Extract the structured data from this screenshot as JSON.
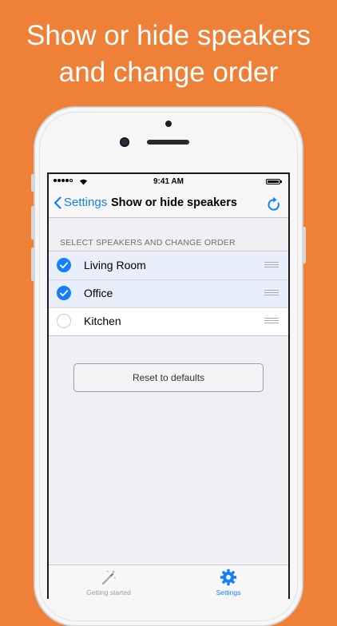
{
  "headline": {
    "line1": "Show or hide speakers",
    "line2": "and change order"
  },
  "status_bar": {
    "time": "9:41 AM",
    "signal_icon": "signal-dots-icon",
    "wifi_icon": "wifi-icon",
    "battery_icon": "battery-icon",
    "battery_level": 1.0
  },
  "nav": {
    "back_label": "Settings",
    "title": "Show or hide speakers",
    "back_icon": "chevron-left-icon",
    "action_icon": "refresh-icon"
  },
  "section": {
    "header": "SELECT SPEAKERS AND CHANGE ORDER"
  },
  "speakers": [
    {
      "label": "Living Room",
      "checked": true
    },
    {
      "label": "Office",
      "checked": true
    },
    {
      "label": "Kitchen",
      "checked": false
    }
  ],
  "reset_button": {
    "label": "Reset to defaults"
  },
  "tabs": [
    {
      "label": "Getting started",
      "icon": "magic-wand-icon",
      "active": false
    },
    {
      "label": "Settings",
      "icon": "gear-icon",
      "active": true
    }
  ],
  "colors": {
    "background": "#EE8137",
    "accent": "#147EFB",
    "checked_row": "#E9EFFA"
  }
}
